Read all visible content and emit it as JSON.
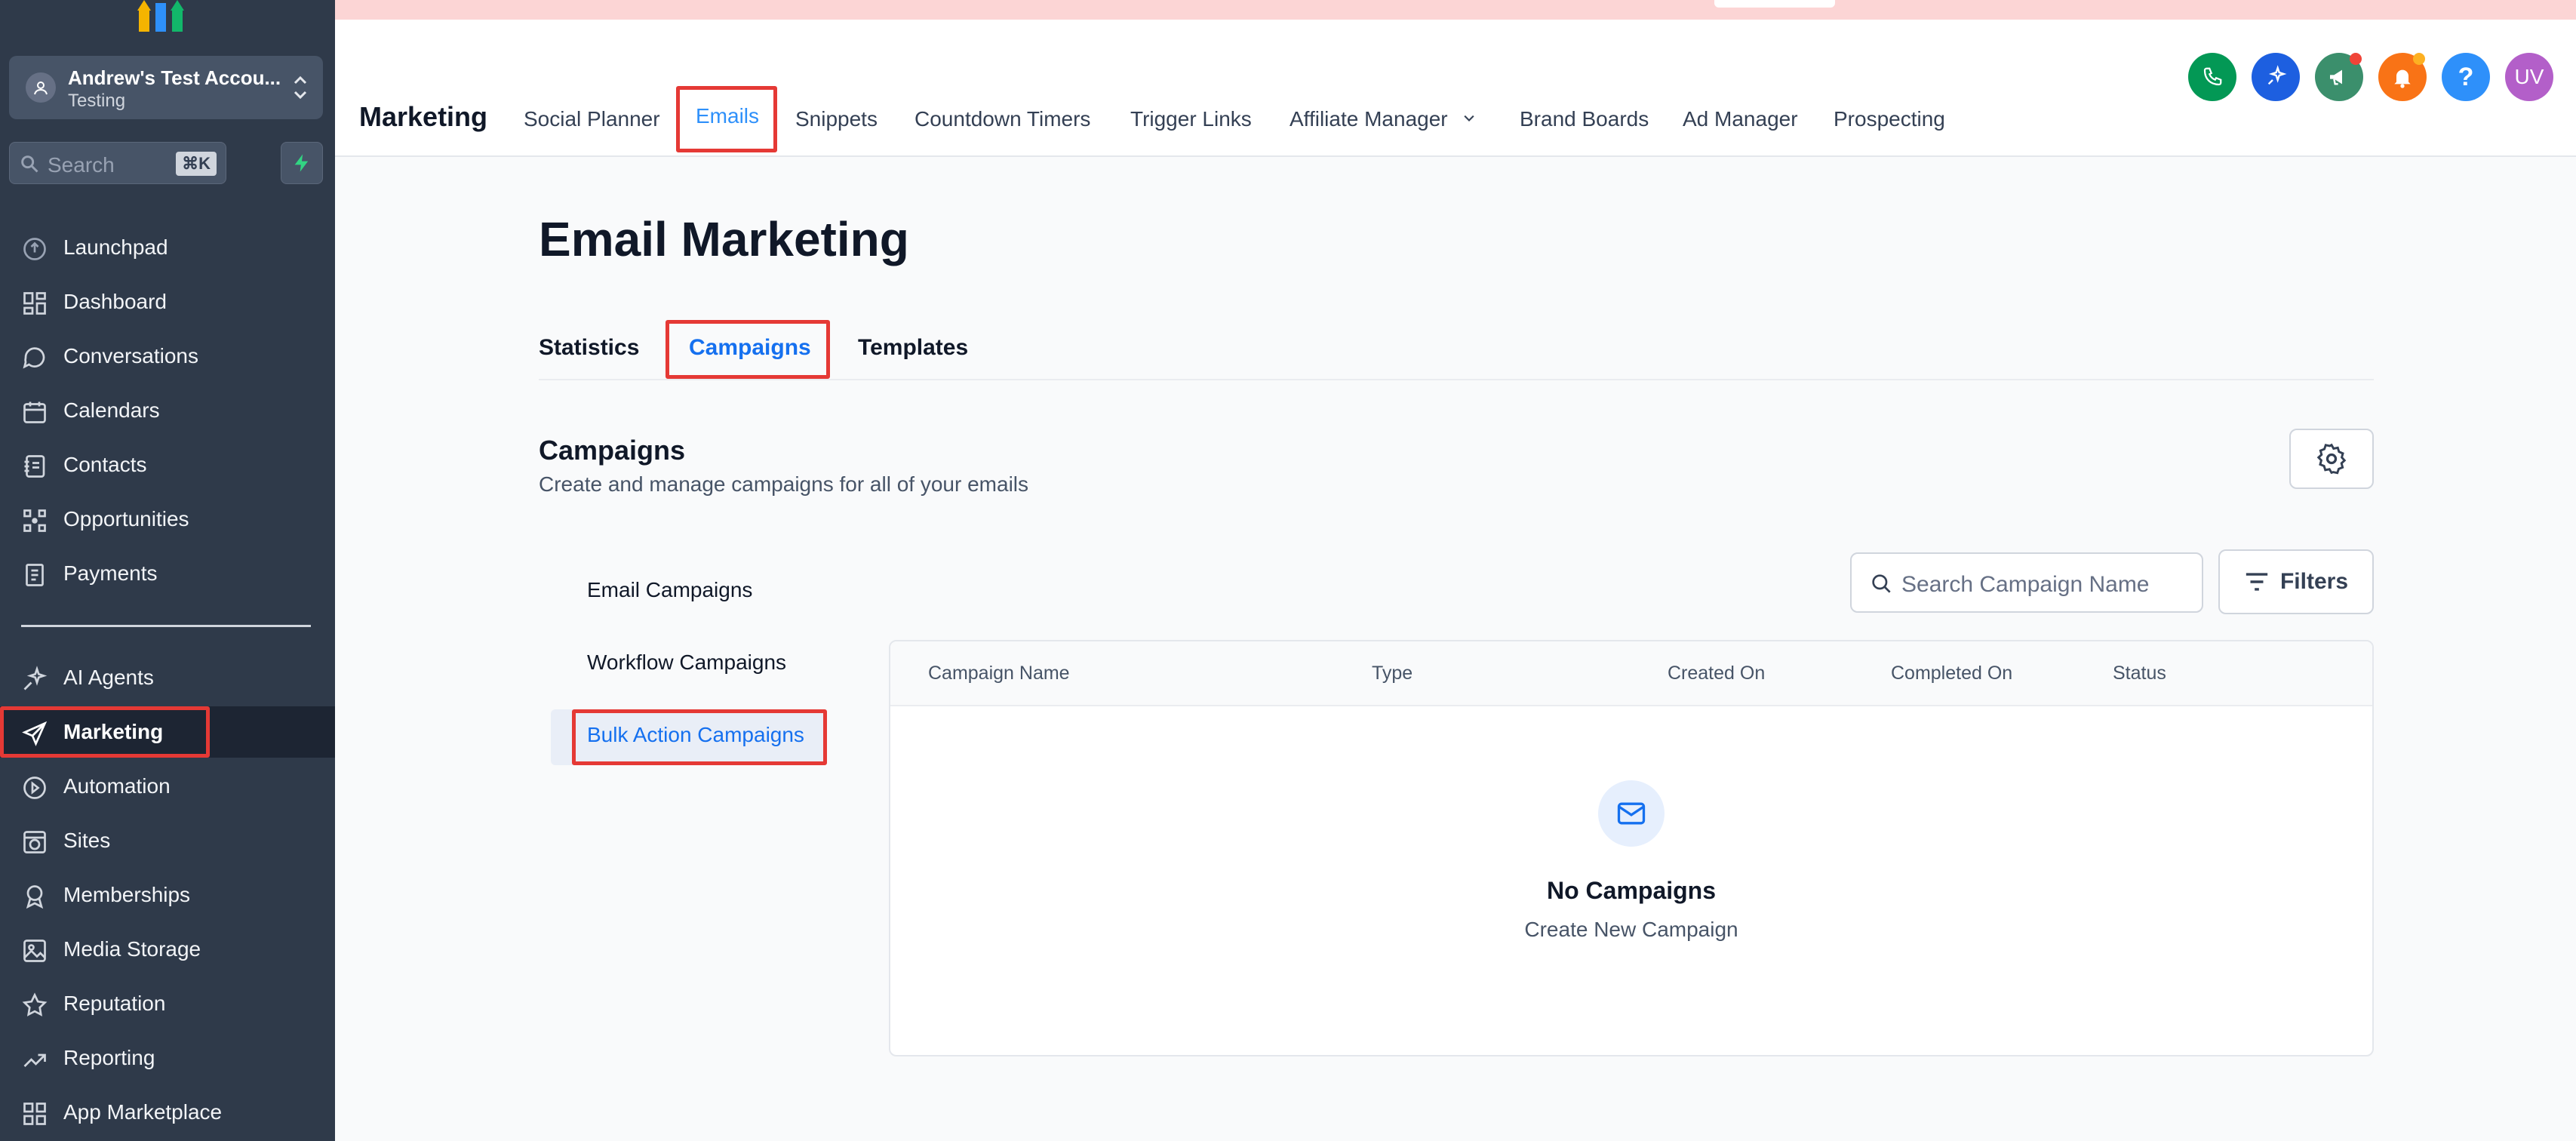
{
  "sidebar": {
    "account": {
      "name": "Andrew's Test Accou...",
      "location": "Testing"
    },
    "search": {
      "placeholder": "Search",
      "shortcut": "⌘K"
    },
    "items": [
      {
        "label": "Launchpad",
        "icon": "rocket-icon"
      },
      {
        "label": "Dashboard",
        "icon": "grid-icon"
      },
      {
        "label": "Conversations",
        "icon": "chat-icon"
      },
      {
        "label": "Calendars",
        "icon": "calendar-icon"
      },
      {
        "label": "Contacts",
        "icon": "contacts-icon"
      },
      {
        "label": "Opportunities",
        "icon": "pipeline-icon"
      },
      {
        "label": "Payments",
        "icon": "receipt-icon"
      },
      {
        "label": "AI Agents",
        "icon": "sparkle-icon"
      },
      {
        "label": "Marketing",
        "icon": "paper-plane-icon",
        "active": true
      },
      {
        "label": "Automation",
        "icon": "automation-icon"
      },
      {
        "label": "Sites",
        "icon": "globe-icon"
      },
      {
        "label": "Memberships",
        "icon": "badge-icon"
      },
      {
        "label": "Media Storage",
        "icon": "image-icon"
      },
      {
        "label": "Reputation",
        "icon": "star-icon"
      },
      {
        "label": "Reporting",
        "icon": "trend-icon"
      },
      {
        "label": "App Marketplace",
        "icon": "apps-icon"
      }
    ]
  },
  "header": {
    "title": "Marketing",
    "nav": [
      {
        "label": "Social Planner"
      },
      {
        "label": "Emails",
        "active": true
      },
      {
        "label": "Snippets"
      },
      {
        "label": "Countdown Timers"
      },
      {
        "label": "Trigger Links"
      },
      {
        "label": "Affiliate Manager"
      },
      {
        "label": "Brand Boards"
      },
      {
        "label": "Ad Manager"
      },
      {
        "label": "Prospecting"
      }
    ],
    "avatar_initials": "UV",
    "help_glyph": "?"
  },
  "main": {
    "title": "Email Marketing",
    "tabs": [
      {
        "label": "Statistics"
      },
      {
        "label": "Campaigns",
        "active": true
      },
      {
        "label": "Templates"
      }
    ],
    "section": {
      "title": "Campaigns",
      "subtitle": "Create and manage campaigns for all of your emails"
    },
    "campaign_types": [
      {
        "label": "Email Campaigns"
      },
      {
        "label": "Workflow Campaigns"
      },
      {
        "label": "Bulk Action Campaigns",
        "active": true
      }
    ],
    "search_placeholder": "Search Campaign Name",
    "filters_label": "Filters",
    "table": {
      "columns": [
        "Campaign Name",
        "Type",
        "Created On",
        "Completed On",
        "Status"
      ],
      "rows": []
    },
    "empty_state": {
      "title": "No Campaigns",
      "subtitle": "Create New Campaign"
    }
  },
  "colors": {
    "sidebar_bg": "#2f3a4a",
    "accent": "#1570ef",
    "highlight_box": "#e53935",
    "phone_green": "#039855",
    "sparkle_blue": "#1d5fe0",
    "megaphone_teal": "#3b8f6c",
    "bell_orange": "#f97316",
    "help_blue": "#2e90fa",
    "avatar_purple": "#b35fc9"
  }
}
